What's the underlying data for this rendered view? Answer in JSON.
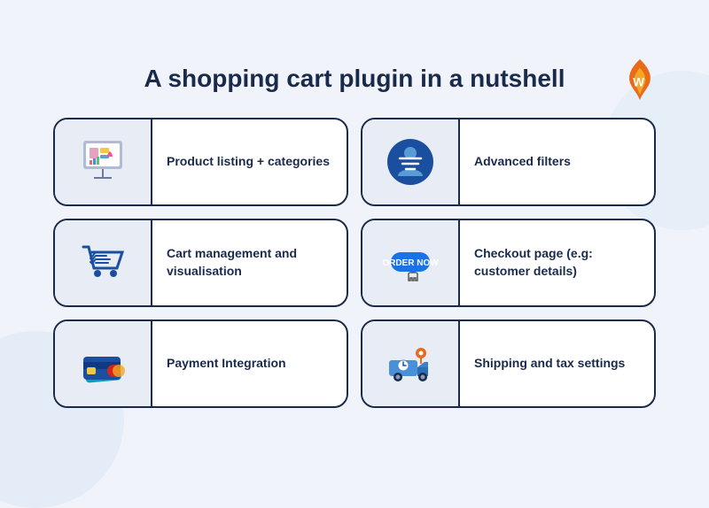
{
  "title": "A shopping cart plugin in a nutshell",
  "logo": {
    "alt": "W logo"
  },
  "cards": [
    {
      "id": "product-listing",
      "label": "Product listing + categories",
      "icon": "product-listing-icon"
    },
    {
      "id": "advanced-filters",
      "label": "Advanced filters",
      "icon": "advanced-filters-icon"
    },
    {
      "id": "cart-management",
      "label": "Cart management and visualisation",
      "icon": "cart-management-icon"
    },
    {
      "id": "checkout-page",
      "label": "Checkout page (e.g: customer details)",
      "icon": "checkout-icon"
    },
    {
      "id": "payment-integration",
      "label": "Payment Integration",
      "icon": "payment-icon"
    },
    {
      "id": "shipping-tax",
      "label": "Shipping and tax settings",
      "icon": "shipping-icon"
    }
  ]
}
